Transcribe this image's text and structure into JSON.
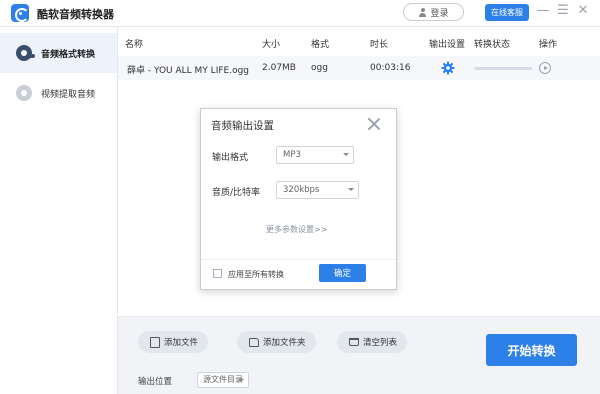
{
  "app": {
    "title": "酷软音频转换器"
  },
  "header": {
    "login_label": "登录",
    "service_label": "在线客服"
  },
  "window_controls": {
    "minimize": "—",
    "menu": "☰",
    "close": "✕"
  },
  "sidebar": {
    "items": [
      {
        "label": "音频格式转换",
        "icon": "film-reel-icon",
        "active": true
      },
      {
        "label": "视频提取音频",
        "icon": "reel-icon",
        "active": false
      }
    ]
  },
  "table": {
    "columns": [
      "名称",
      "大小",
      "格式",
      "时长",
      "输出设置",
      "转换状态",
      "操作"
    ],
    "rows": [
      {
        "name": "薛卓 - YOU ALL MY LIFE.ogg",
        "size": "2.07MB",
        "format": "ogg",
        "duration": "00:03:16",
        "progress": 0.0
      }
    ]
  },
  "bottom": {
    "add_file_label": "添加文件",
    "add_folder_label": "添加文件夹",
    "clear_list_label": "清空列表",
    "output_label": "输出位置",
    "output_value": "源文件目录",
    "start_label": "开始转换"
  },
  "dialog": {
    "title": "音频输出设置",
    "format_label": "输出格式",
    "format_value": "MP3",
    "bitrate_label": "音质/比特率",
    "bitrate_value": "320kbps",
    "more_settings": "更多参数设置>>",
    "apply_all_label": "应用至所有转换",
    "ok_label": "确定"
  },
  "colors": {
    "accent": "#2d80e8",
    "sidebar_active_bg": "#eef2fa",
    "bottom_bar_bg": "#f1f3f7"
  }
}
